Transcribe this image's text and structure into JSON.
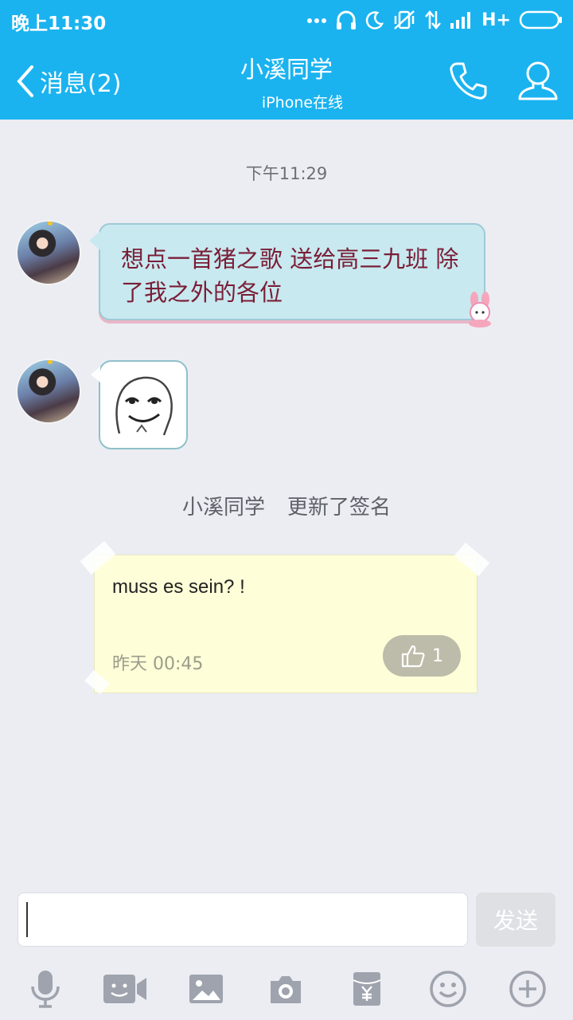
{
  "status_bar": {
    "time": "晚上11:30",
    "network": "H+"
  },
  "nav": {
    "back_label": "消息(2)",
    "title": "小溪同学",
    "subtitle": "iPhone在线"
  },
  "chat": {
    "timestamp": "下午11:29",
    "messages": [
      {
        "type": "text",
        "text": "想点一首猪之歌 送给高三九班 除了我之外的各位"
      },
      {
        "type": "sticker",
        "sticker": "smirk-face-sticker"
      }
    ],
    "system_notice": {
      "name": "小溪同学",
      "action": "更新了签名"
    },
    "signature_card": {
      "text": "muss es sein? !",
      "time": "昨天 00:45",
      "likes": "1"
    }
  },
  "input": {
    "value": "",
    "send_label": "发送"
  },
  "toolbar": [
    "voice-icon",
    "video-call-icon",
    "image-icon",
    "camera-icon",
    "red-packet-icon",
    "emoji-icon",
    "plus-icon"
  ],
  "colors": {
    "header_bg": "#1ab3f0",
    "bubble_bg": "#c8e9ef",
    "bubble_text": "#7a1e37",
    "signature_bg": "#fefed8"
  }
}
